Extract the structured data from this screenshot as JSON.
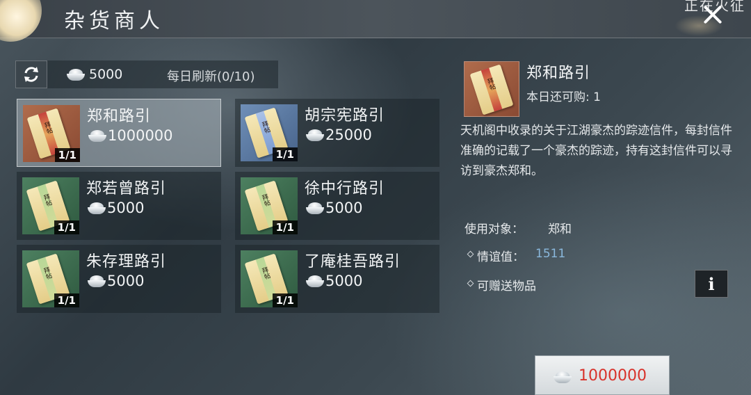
{
  "header": {
    "title": "杂货商人",
    "corner_text": "正在火征"
  },
  "topbar": {
    "money": "5000",
    "refresh_label": "每日刷新(0/10)"
  },
  "items": [
    {
      "name": "郑和路引",
      "price": "1000000",
      "qty": "1/1",
      "color": "red"
    },
    {
      "name": "胡宗宪路引",
      "price": "25000",
      "qty": "1/1",
      "color": "blue"
    },
    {
      "name": "郑若曾路引",
      "price": "5000",
      "qty": "1/1",
      "color": "green"
    },
    {
      "name": "徐中行路引",
      "price": "5000",
      "qty": "1/1",
      "color": "green"
    },
    {
      "name": "朱存理路引",
      "price": "5000",
      "qty": "1/1",
      "color": "green"
    },
    {
      "name": "了庵桂吾路引",
      "price": "5000",
      "qty": "1/1",
      "color": "green"
    }
  ],
  "letter_glyph": "拜帖",
  "detail": {
    "name": "郑和路引",
    "remaining": "本日还可购: 1",
    "description": "天机阁中收录的关于江湖豪杰的踪迹信件，每封信件准确的记载了一个豪杰的踪迹，持有这封信件可以寻访到豪杰郑和。",
    "target_label": "使用对象：",
    "target_value": "郑和",
    "affinity_label": "情谊值：",
    "affinity_value": "1511",
    "gift_label": "可赠送物品",
    "info_label": "i",
    "buy_price": "1000000"
  },
  "colors": {
    "price_red": "#d8322b",
    "affinity_blue": "#8ab8dc"
  },
  "icons": [
    "refresh-icon",
    "silver-ingot-icon",
    "close-icon",
    "info-icon"
  ]
}
